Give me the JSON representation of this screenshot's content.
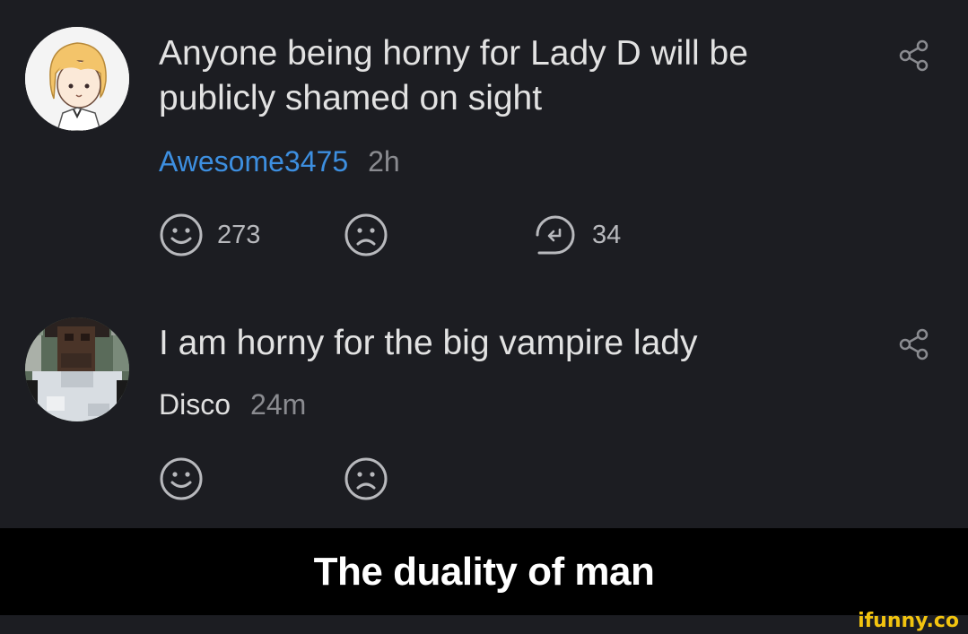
{
  "comments": [
    {
      "text": "Anyone being horny for Lady D will be publicly shamed on sight",
      "author": "Awesome3475",
      "time": "2h",
      "likes": "273",
      "replies": "34"
    },
    {
      "text": "I am horny for the big vampire lady",
      "author": "Disco",
      "time": "24m"
    }
  ],
  "caption": "The duality of man",
  "watermark": "ifunny.co",
  "colors": {
    "background": "#1c1d22",
    "link": "#3d8fe0",
    "caption_bar": "#000000",
    "watermark": "#f2c40f"
  },
  "icons": [
    "smile-icon",
    "frown-icon",
    "reply-icon",
    "share-icon"
  ]
}
